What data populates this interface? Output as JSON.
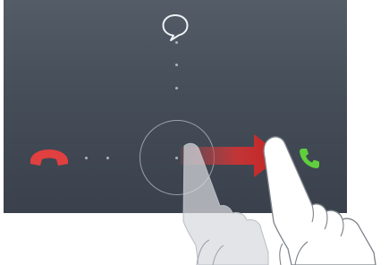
{
  "lockscreen": {
    "targets": {
      "top": {
        "icon": "message-bubble-icon"
      },
      "left": {
        "icon": "decline-call-icon"
      },
      "right": {
        "icon": "answer-call-icon"
      }
    },
    "gesture": {
      "action": "swipe-right",
      "icon": "swipe-right-arrow-icon"
    }
  },
  "colors": {
    "screen_top": "#535c67",
    "screen_bottom": "#3a414c",
    "decline": "#e04040",
    "answer": "#5fcf3c",
    "arrow": "#d32f2f",
    "icon": "#eef1f4"
  }
}
